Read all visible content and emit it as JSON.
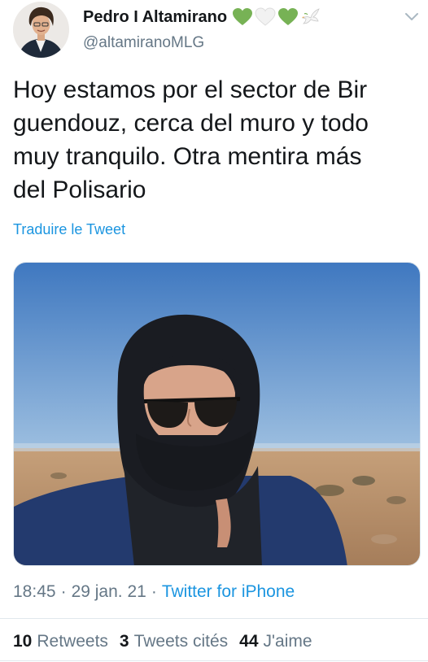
{
  "author": {
    "display_name": "Pedro I Altamirano",
    "handle": "@altamiranoMLG",
    "name_emojis": [
      "green-heart-icon",
      "white-heart-icon",
      "green-heart-icon",
      "dove-icon"
    ]
  },
  "tweet": {
    "text": "Hoy estamos por el sector de Bir\nguendouz, cerca del muro y todo\nmuy tranquilo. Otra mentira más\ndel Polisario",
    "translate_label": "Traduire le Tweet",
    "time": "18:45",
    "date": "29 jan. 21",
    "source": "Twitter for iPhone",
    "separator": "·"
  },
  "stats": {
    "retweets_count": "10",
    "retweets_label": "Retweets",
    "quotes_count": "3",
    "quotes_label": "Tweets cités",
    "likes_count": "44",
    "likes_label": "J'aime"
  },
  "colors": {
    "link": "#1b95e0",
    "secondary_text": "#657786",
    "primary_text": "#14171a",
    "green_heart": "#77b255"
  }
}
